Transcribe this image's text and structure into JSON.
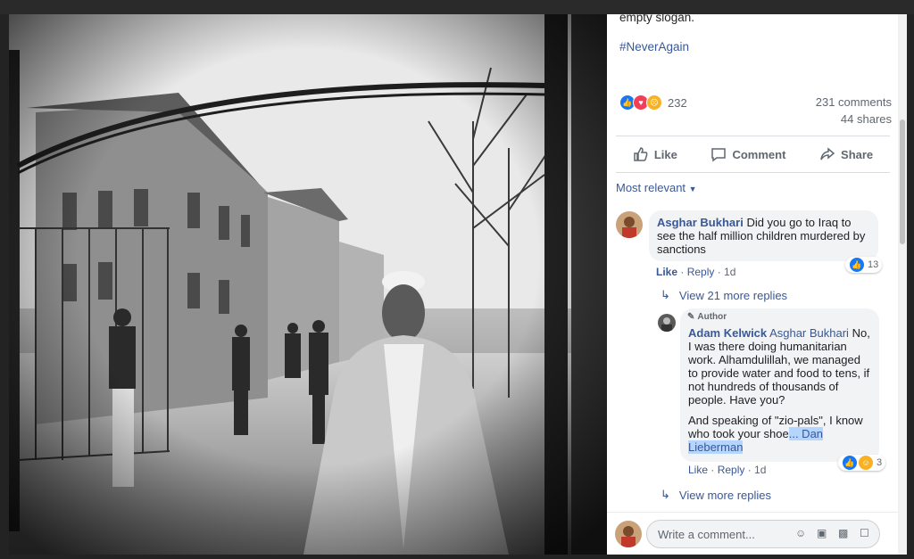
{
  "post": {
    "text_tail": "empty slogan.",
    "hashtag": "#NeverAgain",
    "reactions_count": "232",
    "comments": "231 comments",
    "shares": "44 shares"
  },
  "actions": {
    "like": "Like",
    "comment": "Comment",
    "share": "Share"
  },
  "sort_label": "Most relevant",
  "comments": [
    {
      "author": "Asghar Bukhari",
      "text": "Did you go to Iraq to see the half million children murdered by sanctions",
      "like": "Like",
      "reply": "Reply",
      "time": "1d",
      "reactions": "13",
      "more_replies": "View 21 more replies"
    }
  ],
  "reply": {
    "author_tag": "Author",
    "author": "Adam Kelwick",
    "mention": "Asghar Bukhari",
    "text1": "No, I was there doing humanitarian work. Alhamdulillah, we managed to provide water and food to tens, if not hundreds of thousands of people. Have you?",
    "text2_plain": "And speaking of \"zio-pals\", I know who took your shoe",
    "text2_highlight": "... Dan Lieberman",
    "like": "Like",
    "reply_label": "Reply",
    "time": "1d",
    "reactions": "3"
  },
  "view_more_replies": "View more replies",
  "comment_box": {
    "placeholder": "Write a comment..."
  },
  "colors": {
    "link": "#385898",
    "like_blue": "#1877f2",
    "love_red": "#f33e58",
    "sad_yellow": "#f7b125"
  }
}
